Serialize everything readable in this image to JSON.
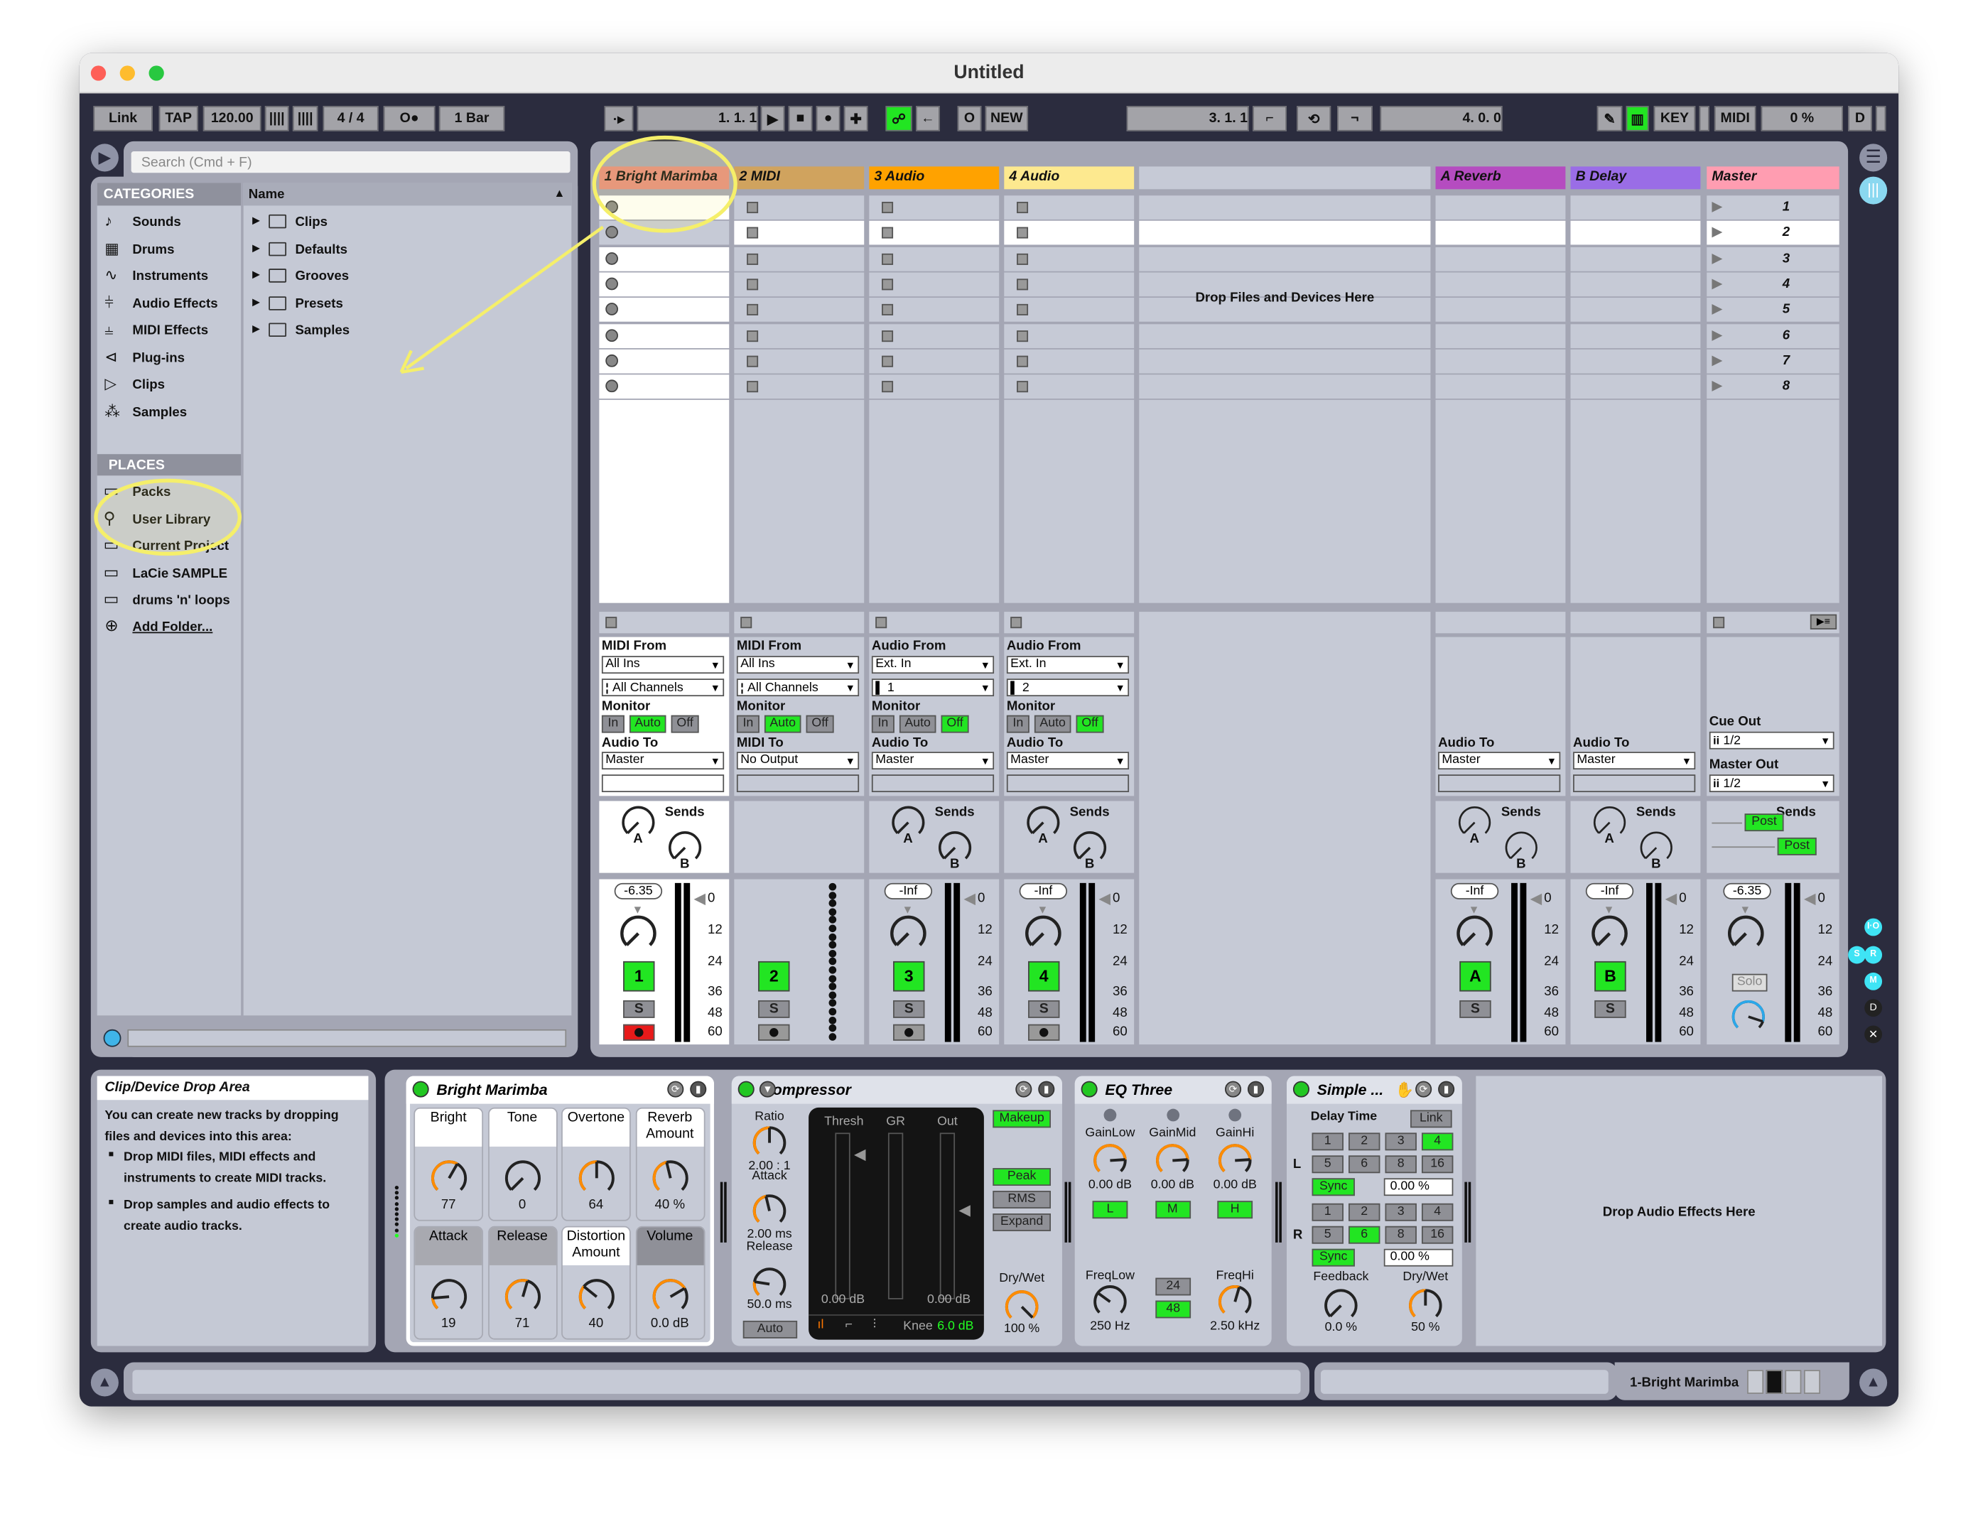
{
  "window": {
    "title": "Untitled"
  },
  "toolbar": {
    "link": "Link",
    "tap": "TAP",
    "tempo": "120.00",
    "signature": "4 / 4",
    "metronome": "O●",
    "quantize": "1 Bar",
    "position": "1.   1.   1",
    "new": "NEW",
    "loop_start": "3.   1.   1",
    "loop_length": "4.   0.   0",
    "key": "KEY",
    "midi": "MIDI",
    "cpu": "0 %",
    "d": "D"
  },
  "browser": {
    "search_placeholder": "Search (Cmd + F)",
    "categories_header": "CATEGORIES",
    "categories": [
      {
        "label": "Sounds",
        "icon": "note-icon"
      },
      {
        "label": "Drums",
        "icon": "grid-icon"
      },
      {
        "label": "Instruments",
        "icon": "waveform-icon"
      },
      {
        "label": "Audio Effects",
        "icon": "audio-effects-icon"
      },
      {
        "label": "MIDI Effects",
        "icon": "midi-effects-icon"
      },
      {
        "label": "Plug-ins",
        "icon": "plugin-icon"
      },
      {
        "label": "Clips",
        "icon": "clip-icon"
      },
      {
        "label": "Samples",
        "icon": "sample-icon"
      }
    ],
    "places_header": "PLACES",
    "places": [
      {
        "label": "Packs",
        "icon": "packs-icon"
      },
      {
        "label": "User Library",
        "icon": "user-icon"
      },
      {
        "label": "Current Project",
        "icon": "project-icon"
      },
      {
        "label": "LaCie SAMPLE",
        "icon": "folder-icon"
      },
      {
        "label": "drums 'n' loops",
        "icon": "folder-icon"
      }
    ],
    "add_folder": "Add Folder...",
    "name_header": "Name",
    "folders": [
      "Clips",
      "Defaults",
      "Grooves",
      "Presets",
      "Samples"
    ]
  },
  "session": {
    "drop_files": "Drop Files and Devices Here",
    "scenes": [
      "1",
      "2",
      "3",
      "4",
      "5",
      "6",
      "7",
      "8"
    ],
    "meter_ticks": [
      "0",
      "12",
      "24",
      "36",
      "48",
      "60"
    ],
    "sends_label": "Sends",
    "monitor_label": "Monitor",
    "monitor_options": [
      "In",
      "Auto",
      "Off"
    ],
    "tracks": [
      {
        "name": "1 Bright Marimba",
        "color": "#e58d7e",
        "in_label": "MIDI From",
        "in": "All Ins",
        "ch": "All Channels",
        "monitor": "Auto",
        "out_label": "Audio To",
        "out": "Master",
        "volume": "-6.35",
        "number": "1",
        "solo": "S",
        "armed": true
      },
      {
        "name": "2 MIDI",
        "color": "#d0a35e",
        "in_label": "MIDI From",
        "in": "All Ins",
        "ch": "All Channels",
        "monitor": "Auto",
        "out_label": "MIDI To",
        "out": "No Output",
        "number": "2",
        "solo": "S",
        "armed": false
      },
      {
        "name": "3 Audio",
        "color": "#ffa200",
        "in_label": "Audio From",
        "in": "Ext. In",
        "ch": "1",
        "monitor": "Off",
        "out_label": "Audio To",
        "out": "Master",
        "volume": "-Inf",
        "number": "3",
        "solo": "S",
        "armed": false
      },
      {
        "name": "4 Audio",
        "color": "#fde98f",
        "in_label": "Audio From",
        "in": "Ext. In",
        "ch": "2",
        "monitor": "Off",
        "out_label": "Audio To",
        "out": "Master",
        "volume": "-Inf",
        "number": "4",
        "solo": "S",
        "armed": false
      }
    ],
    "returns": [
      {
        "name": "A Reverb",
        "color": "#b54cc0",
        "out_label": "Audio To",
        "out": "Master",
        "volume": "-Inf",
        "letter": "A",
        "solo": "S"
      },
      {
        "name": "B Delay",
        "color": "#9a6de6",
        "out_label": "Audio To",
        "out": "Master",
        "volume": "-Inf",
        "letter": "B",
        "solo": "S"
      }
    ],
    "master": {
      "name": "Master",
      "color": "#ff9db1",
      "cue_label": "Cue Out",
      "cue": "1/2",
      "out_label": "Master Out",
      "out": "1/2",
      "post": "Post",
      "volume": "-6.35",
      "solo": "Solo"
    },
    "side_buttons": [
      "I·O",
      "S",
      "R",
      "M"
    ]
  },
  "info": {
    "title": "Clip/Device Drop Area",
    "body": "You can create new tracks by dropping files and devices into this area:",
    "bullets": [
      "Drop MIDI files, MIDI effects and instruments to create MIDI tracks.",
      "Drop samples and audio effects to create audio tracks."
    ]
  },
  "devices": {
    "instrument": {
      "name": "Bright Marimba",
      "params": [
        {
          "label": "Bright",
          "value": "77",
          "level": 0.61,
          "active": true
        },
        {
          "label": "Tone",
          "value": "0",
          "level": 0,
          "active": true
        },
        {
          "label": "Overtone",
          "value": "64",
          "level": 0.5,
          "active": true
        },
        {
          "label": "Reverb Amount",
          "value": "40 %",
          "level": 0.45,
          "active": true
        },
        {
          "label": "Attack",
          "value": "19",
          "level": 0.15,
          "active": false
        },
        {
          "label": "Release",
          "value": "71",
          "level": 0.56,
          "active": false
        },
        {
          "label": "Distortion Amount",
          "value": "40",
          "level": 0.31,
          "active": true
        },
        {
          "label": "Volume",
          "value": "0.0 dB",
          "level": 0.72,
          "active": false
        }
      ]
    },
    "compressor": {
      "name": "Compressor",
      "ratio_label": "Ratio",
      "ratio": "2.00 : 1",
      "ratio_level": 0.5,
      "attack_label": "Attack",
      "attack": "2.00 ms",
      "attack_level": 0.45,
      "release_label": "Release",
      "release": "50.0 ms",
      "release_level": 0.2,
      "auto": "Auto",
      "thresh": "Thresh",
      "gr": "GR",
      "out": "Out",
      "thresh_value": "0.00 dB",
      "out_value": "0.00 dB",
      "knee_label": "Knee",
      "knee": "6.0 dB",
      "makeup": "Makeup",
      "peak": "Peak",
      "rms": "RMS",
      "expand": "Expand",
      "drywet_label": "Dry/Wet",
      "drywet": "100 %",
      "drywet_level": 1.0
    },
    "eq": {
      "name": "EQ Three",
      "gains": [
        {
          "label": "GainLow",
          "value": "0.00 dB",
          "level": 0.82,
          "band": "L"
        },
        {
          "label": "GainMid",
          "value": "0.00 dB",
          "level": 0.82,
          "band": "M"
        },
        {
          "label": "GainHi",
          "value": "0.00 dB",
          "level": 0.82,
          "band": "H"
        }
      ],
      "freqlow_label": "FreqLow",
      "freqlow": "250 Hz",
      "freqlow_level": 0.3,
      "freqhi_label": "FreqHi",
      "freqhi": "2.50 kHz",
      "freqhi_level": 0.56,
      "slope": [
        "24",
        "48"
      ],
      "slope_selected": "48"
    },
    "delay": {
      "name": "Simple ...",
      "delay_time": "Delay Time",
      "link": "Link",
      "beats": [
        "1",
        "2",
        "3",
        "4",
        "5",
        "6",
        "8",
        "16"
      ],
      "left_label": "L",
      "left_selected": "4",
      "right_label": "R",
      "right_selected": "6",
      "sync": "Sync",
      "left_offset": "0.00 %",
      "right_offset": "0.00 %",
      "feedback_label": "Feedback",
      "feedback": "0.0 %",
      "feedback_level": 0,
      "drywet_label": "Dry/Wet",
      "drywet": "50 %",
      "drywet_level": 0.5
    },
    "drop_audio": "Drop Audio Effects Here"
  },
  "status": {
    "selected_track": "1-Bright Marimba"
  },
  "colors": {
    "accent_green": "#22e522",
    "knob_orange": "#ff8c00",
    "annotation_yellow": "#f5ef6a"
  }
}
